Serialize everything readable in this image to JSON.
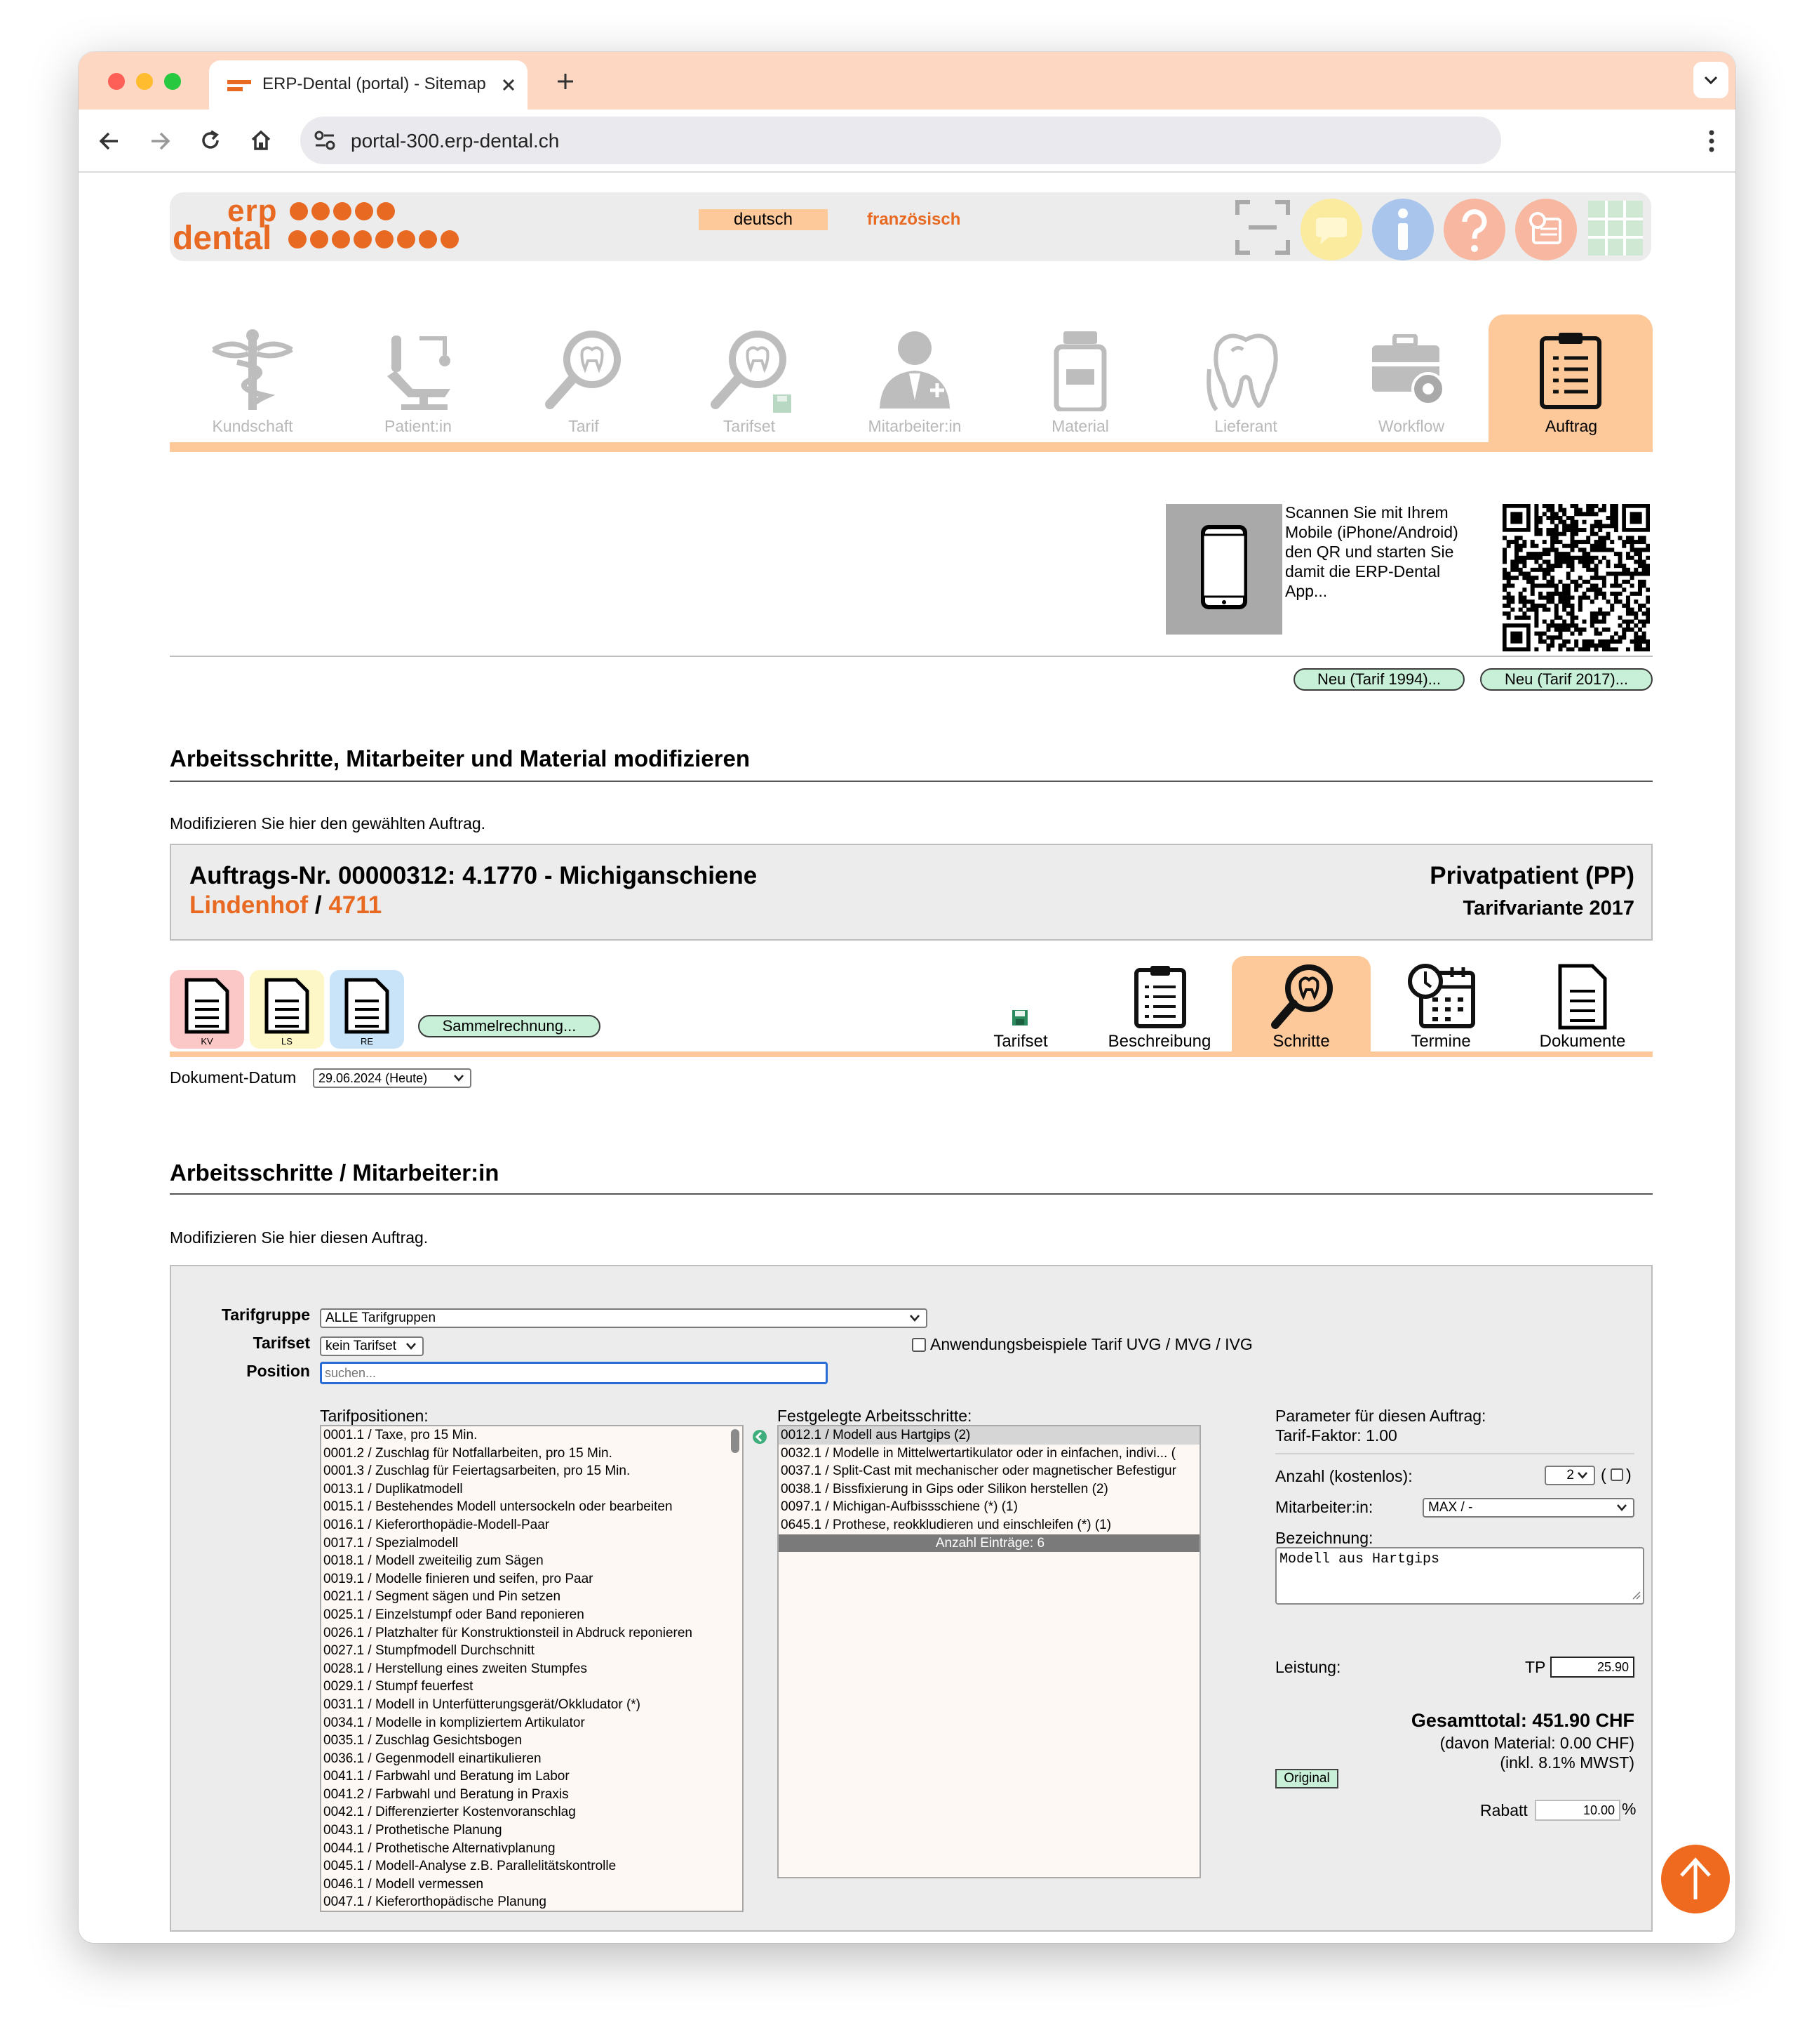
{
  "browser": {
    "tab_title": "ERP-Dental (portal) - Sitemap",
    "url": "portal-300.erp-dental.ch",
    "new_tab_label": "+"
  },
  "header": {
    "logo_line1": "erp",
    "logo_line2": "dental",
    "lang_active": "deutsch",
    "lang_other": "französisch"
  },
  "nav": {
    "items": [
      {
        "label": "Kundschaft",
        "icon": "caduceus-icon"
      },
      {
        "label": "Patient:in",
        "icon": "dental-chair-icon"
      },
      {
        "label": "Tarif",
        "icon": "tooth-magnifier-icon"
      },
      {
        "label": "Tarifset",
        "icon": "tooth-magnifier-save-icon"
      },
      {
        "label": "Mitarbeiter:in",
        "icon": "employee-icon"
      },
      {
        "label": "Material",
        "icon": "jar-icon"
      },
      {
        "label": "Lieferant",
        "icon": "tooth-outline-icon"
      },
      {
        "label": "Workflow",
        "icon": "toolbox-gear-icon"
      },
      {
        "label": "Auftrag",
        "icon": "clipboard-icon"
      }
    ],
    "active": "Auftrag"
  },
  "qr": {
    "text": "Scannen Sie mit Ihrem Mobile (iPhone/Android) den QR und starten Sie damit die ERP-Dental App..."
  },
  "new_buttons": {
    "tarif1994": "Neu (Tarif 1994)...",
    "tarif2017": "Neu (Tarif 2017)..."
  },
  "section1": {
    "title": "Arbeitsschritte, Mitarbeiter und Material modifizieren",
    "subtitle": "Modifizieren Sie hier den gewählten Auftrag."
  },
  "order": {
    "title": "Auftrags-Nr. 00000312: 4.1770 - Michiganschiene",
    "client": "Lindenhof",
    "separator": "/",
    "number": "4711",
    "patient_type": "Privatpatient (PP)",
    "tarif_variant": "Tarifvariante 2017"
  },
  "docs": {
    "kv": "KV",
    "ls": "LS",
    "re": "RE",
    "sammel": "Sammelrechnung...",
    "date_label": "Dokument-Datum",
    "date_value": "29.06.2024 (Heute)"
  },
  "order_tabs": [
    {
      "label": "Tarifset",
      "icon": "floppy-disk-icon"
    },
    {
      "label": "Beschreibung",
      "icon": "clipboard-list-icon"
    },
    {
      "label": "Schritte",
      "icon": "tooth-magnifier-icon"
    },
    {
      "label": "Termine",
      "icon": "calendar-clock-icon"
    },
    {
      "label": "Dokumente",
      "icon": "document-icon"
    }
  ],
  "order_tab_active": "Schritte",
  "section2": {
    "title": "Arbeitsschritte / Mitarbeiter:in",
    "subtitle": "Modifizieren Sie hier diesen Auftrag."
  },
  "filters": {
    "tarifgruppe_label": "Tarifgruppe",
    "tarifgruppe_value": "ALLE Tarifgruppen",
    "tarifset_label": "Tarifset",
    "tarifset_value": "kein Tarifset",
    "position_label": "Position",
    "position_placeholder": "suchen...",
    "anwendung_label": "Anwendungsbeispiele Tarif UVG / MVG / IVG"
  },
  "tarifpositionen": {
    "label": "Tarifpositionen:",
    "items": [
      "0001.1 / Taxe, pro 15 Min.",
      "0001.2 / Zuschlag für Notfallarbeiten, pro 15 Min.",
      "0001.3 / Zuschlag für Feiertagsarbeiten, pro 15 Min.",
      "0013.1 / Duplikatmodell",
      "0015.1 / Bestehendes Modell untersockeln oder bearbeiten",
      "0016.1 / Kieferorthopädie-Modell-Paar",
      "0017.1 / Spezialmodell",
      "0018.1 / Modell zweiteilig zum Sägen",
      "0019.1 / Modelle finieren und seifen, pro Paar",
      "0021.1 / Segment sägen und Pin setzen",
      "0025.1 / Einzelstumpf oder Band reponieren",
      "0026.1 / Platzhalter für Konstruktionsteil in Abdruck reponieren",
      "0027.1 / Stumpfmodell Durchschnitt",
      "0028.1 / Herstellung eines zweiten Stumpfes",
      "0029.1 / Stumpf feuerfest",
      "0031.1 / Modell in Unterfütterungsgerät/Okkludator (*)",
      "0034.1 / Modelle in kompliziertem Artikulator",
      "0035.1 / Zuschlag Gesichtsbogen",
      "0036.1 / Gegenmodell einartikulieren",
      "0041.1 / Farbwahl und Beratung im Labor",
      "0041.2 / Farbwahl und Beratung in Praxis",
      "0042.1 / Differenzierter Kostenvoranschlag",
      "0043.1 / Prothetische Planung",
      "0044.1 / Prothetische Alternativplanung",
      "0045.1 / Modell-Analyse z.B. Parallelitätskontrolle",
      "0046.1 / Modell vermessen",
      "0047.1 / Kieferorthopädische Planung"
    ]
  },
  "festgelegt": {
    "label": "Festgelegte Arbeitsschritte:",
    "items": [
      "0012.1 / Modell aus Hartgips (2)",
      "0032.1 / Modelle in Mittelwertartikulator oder in einfachen, indivi... (",
      "0037.1 / Split-Cast mit mechanischer oder magnetischer Befestigur",
      "0038.1 / Bissfixierung in Gips oder Silikon herstellen (2)",
      "0097.1 / Michigan-Aufbissschiene (*) (1)",
      "0645.1 / Prothese, reokkludieren und einschleifen (*) (1)"
    ],
    "count": "Anzahl Einträge: 6"
  },
  "params": {
    "title": "Parameter für diesen Auftrag:",
    "faktor": "Tarif-Faktor: 1.00",
    "anzahl_label": "Anzahl (kostenlos):",
    "anzahl_value": "2",
    "paren_open": "(",
    "paren_close": ")",
    "mitarbeiter_label": "Mitarbeiter:in:",
    "mitarbeiter_value": "MAX / -",
    "bezeichnung_label": "Bezeichnung:",
    "bezeichnung_value": "Modell aus Hartgips",
    "leistung_label": "Leistung:",
    "tp_label": "TP",
    "tp_value": "25.90",
    "total": "Gesamttotal: 451.90 CHF",
    "material": "(davon Material: 0.00 CHF)",
    "mwst": "(inkl. 8.1% MWST)",
    "original_label": "Original",
    "rabatt_label": "Rabatt",
    "rabatt_value": "10.00",
    "percent": "%"
  },
  "colors": {
    "accent": "#e86a22",
    "tab_active_bg": "#fdc99b",
    "nav_line": "#fdc99b",
    "green_button": "#c8f0d8"
  }
}
